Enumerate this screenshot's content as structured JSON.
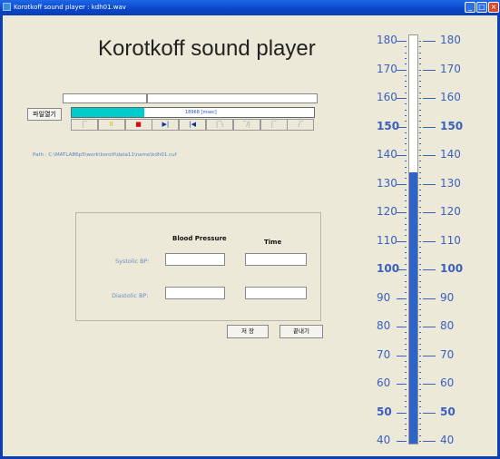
{
  "window": {
    "title": "Korotkoff sound player  : kdh01.wav",
    "minimize": "_",
    "maximize": "□",
    "close": "×"
  },
  "main_title": "Korotkoff sound player",
  "player": {
    "open_button": "파일열기",
    "time_label": "18968 [msec]",
    "playback_progress": 0.3,
    "controls": [
      {
        "symbol": "|‾",
        "color": "#a0a0a0"
      },
      {
        "symbol": "II",
        "color": "#c8b800"
      },
      {
        "symbol": "■",
        "color": "#d01010"
      },
      {
        "symbol": "▶|",
        "color": "#1030a0"
      },
      {
        "symbol": "|◀",
        "color": "#1030a0"
      },
      {
        "symbol": "|‾\\",
        "color": "#a0a0a0"
      },
      {
        "symbol": "‾/|",
        "color": "#a0a0a0"
      },
      {
        "symbol": "|‾",
        "color": "#a0a0a0"
      },
      {
        "symbol": "/‾",
        "color": "#a0a0a0"
      }
    ]
  },
  "path": "Path : C:\\MATLAB6p5\\work\\korotf\\data11\\name\\kdh01.cuf",
  "bp_panel": {
    "col_bp": "Blood Pressure",
    "col_time": "Time",
    "systolic_label": "Systolic BP:",
    "diastolic_label": "Diastolic BP:",
    "systolic_bp": "",
    "systolic_time": "",
    "diastolic_bp": "",
    "diastolic_time": ""
  },
  "save_button": "저 장",
  "exit_button": "끝내기",
  "gauge": {
    "level_mmHg": 133,
    "min": 40,
    "max": 180,
    "left_labels": [
      "180",
      "170",
      "160",
      "150",
      "140",
      "130",
      "120",
      "110",
      "100",
      "90",
      "80",
      "70",
      "60",
      "50",
      "40"
    ],
    "right_labels": [
      "180",
      "170",
      "160",
      "150",
      "140",
      "130",
      "120",
      "110",
      "100",
      "90",
      "80",
      "70",
      "60",
      "50",
      "40"
    ],
    "bold_labels": [
      "150",
      "100",
      "50"
    ],
    "accent_color": "#2e63c8"
  }
}
